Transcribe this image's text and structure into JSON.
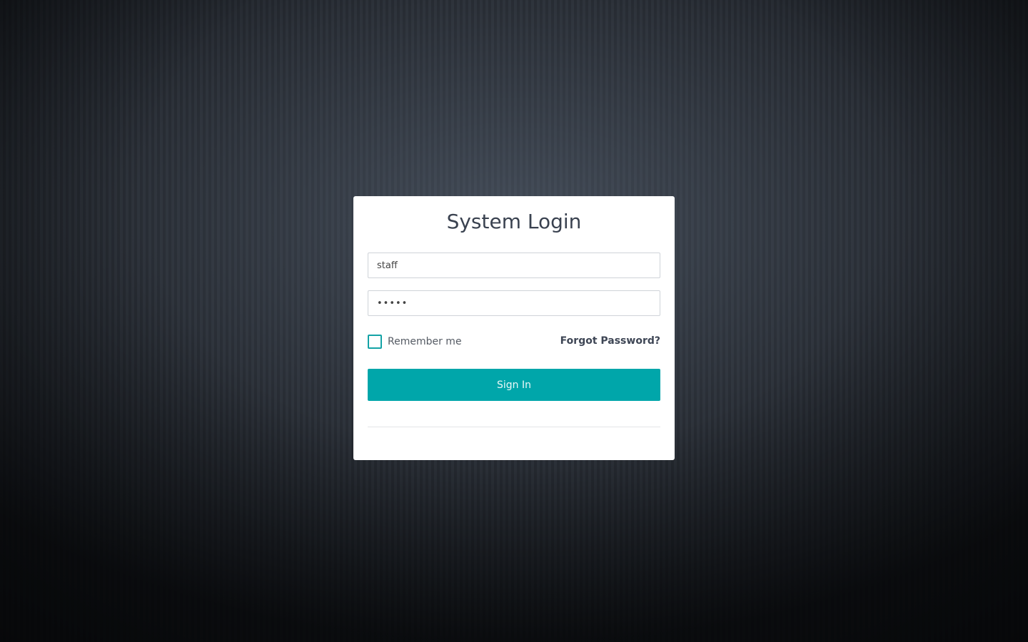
{
  "login": {
    "title": "System Login",
    "username_value": "staff",
    "password_value": "•••••",
    "remember_label": "Remember me",
    "forgot_label": "Forgot Password?",
    "signin_label": "Sign In"
  },
  "colors": {
    "accent": "#00a6aa",
    "title_text": "#3a4250",
    "background": "#2b3038"
  },
  "icons": {
    "checkbox": "checkbox-unchecked-icon"
  }
}
